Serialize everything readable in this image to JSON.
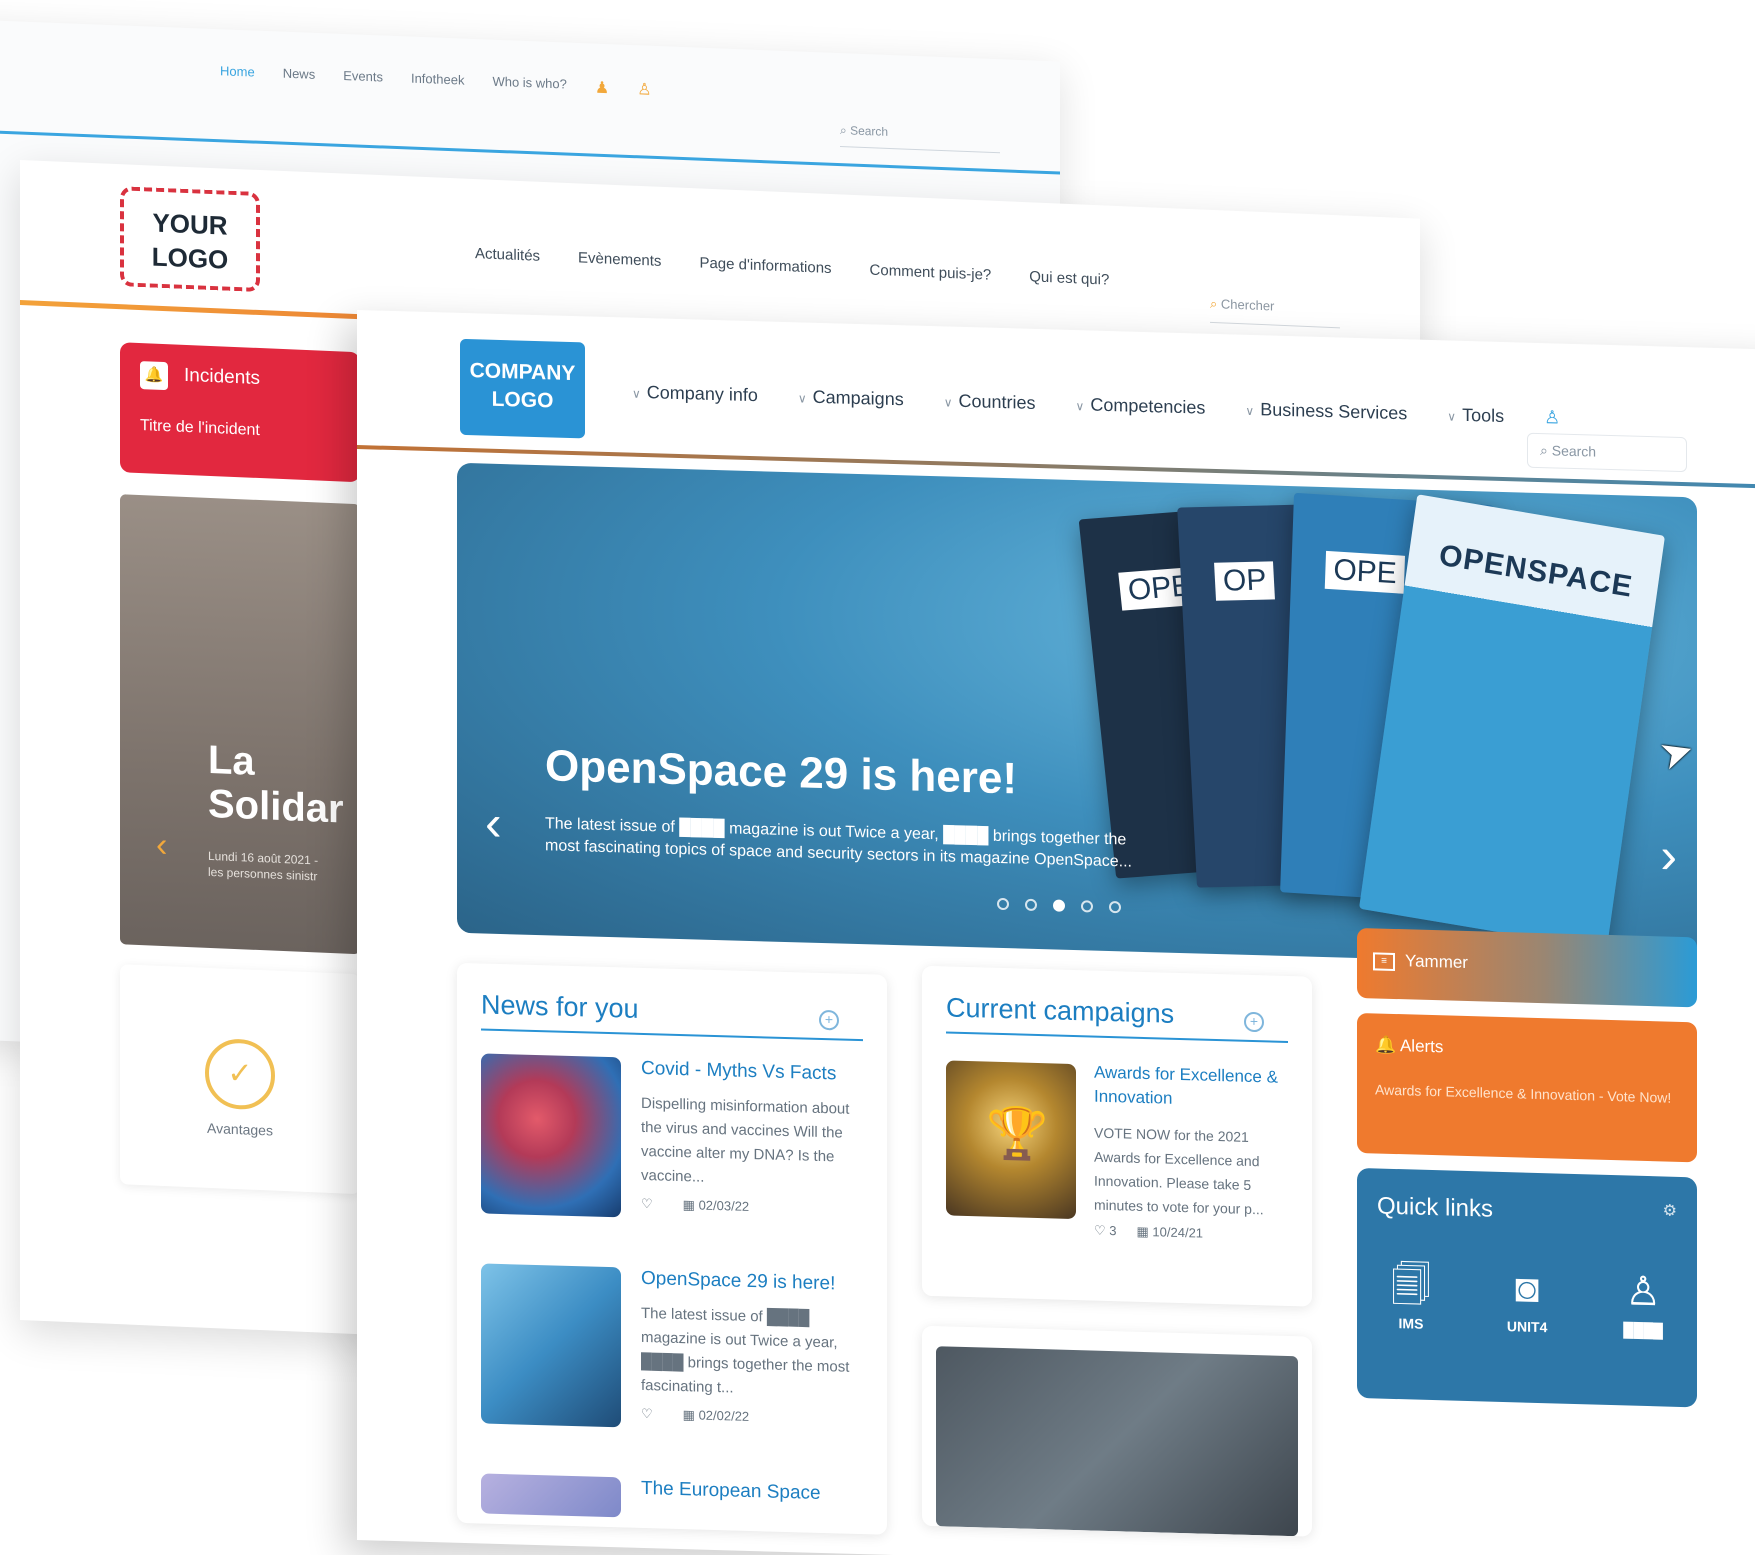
{
  "back": {
    "nav": [
      "Home",
      "News",
      "Events",
      "Infotheek",
      "Who is who?"
    ],
    "search_placeholder": "Search"
  },
  "mid": {
    "logo": {
      "line1": "YOUR",
      "line2": "LOGO"
    },
    "nav": [
      "Actualités",
      "Evènements",
      "Page d'informations",
      "Comment puis-je?",
      "Qui est qui?"
    ],
    "search_placeholder": "Chercher",
    "incidents": {
      "title": "Incidents",
      "subtitle": "Titre de l'incident"
    },
    "photo_card": {
      "big_line1": "La",
      "big_line2": "Solidar",
      "small_line1": "Lundi 16 août 2021 -",
      "small_line2": "les personnes sinistr"
    },
    "avantages_label": "Avantages"
  },
  "front": {
    "logo": {
      "line1": "COMPANY",
      "line2": "LOGO"
    },
    "nav": [
      "Company info",
      "Campaigns",
      "Countries",
      "Competencies",
      "Business Services",
      "Tools"
    ],
    "search_placeholder": "Search",
    "hero": {
      "title": "OpenSpace 29 is here!",
      "desc_line1": "The latest issue of ████ magazine is out Twice a year, ████ brings together the",
      "desc_line2": "most fascinating topics of  space and security sectors in its magazine OpenSpace...",
      "magazine_label": "OPENSPACE",
      "mag_spine_1": "OPE",
      "mag_spine_2": "OP",
      "mag_spine_3": "OPE",
      "slide_count": 5,
      "active_slide": 3
    },
    "news": {
      "title": "News for you",
      "items": [
        {
          "title": "Covid - Myths Vs Facts",
          "body": "Dispelling misinformation about the virus and vaccines Will the vaccine alter my DNA? Is the vaccine...",
          "date": "02/03/22"
        },
        {
          "title": "OpenSpace 29 is here!",
          "body": "The latest issue of ████ magazine is out Twice a year, ████ brings together the most fascinating t...",
          "date": "02/02/22"
        },
        {
          "title": "The European Space",
          "body": "",
          "date": ""
        }
      ]
    },
    "campaigns": {
      "title": "Current campaigns",
      "item": {
        "title": "Awards for Excellence & Innovation",
        "body": "VOTE NOW for the 2021 Awards for Excellence and Innovation. Please take 5 minutes to vote for your p...",
        "likes": "3",
        "date": "10/24/21"
      }
    },
    "yammer": {
      "label": "Yammer"
    },
    "alerts": {
      "title": "Alerts",
      "text": "Awards for Excellence & Innovation - Vote Now!"
    },
    "quick_links": {
      "title": "Quick links",
      "links": [
        {
          "label": "IMS",
          "icon": "document-icon"
        },
        {
          "label": "UNIT4",
          "icon": "disk-icon"
        },
        {
          "label": "████",
          "icon": "add-user-icon"
        }
      ]
    }
  },
  "colors": {
    "brand_blue": "#2a93d5",
    "incident_red": "#e2283f",
    "alert_orange": "#ef7a2e",
    "quick_links_blue": "#2d77a8"
  }
}
